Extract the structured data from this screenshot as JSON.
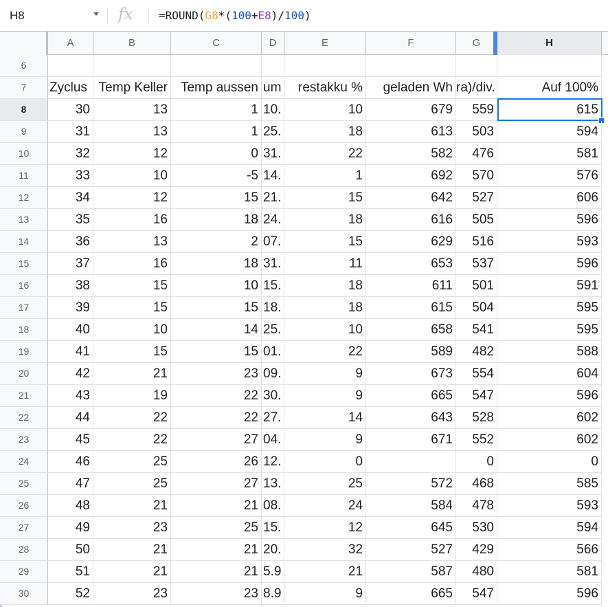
{
  "formula_bar": {
    "cell_ref": "H8",
    "fx_symbol": "fx",
    "formula_parts": [
      {
        "text": "=ROUND(",
        "color": "#202124"
      },
      {
        "text": "G8",
        "color": "#f4a62a"
      },
      {
        "text": "*(",
        "color": "#202124"
      },
      {
        "text": "100",
        "color": "#1155cc"
      },
      {
        "text": "+",
        "color": "#202124"
      },
      {
        "text": "E8",
        "color": "#9334e6"
      },
      {
        "text": ")/",
        "color": "#202124"
      },
      {
        "text": "100",
        "color": "#1155cc"
      },
      {
        "text": ")",
        "color": "#202124"
      }
    ]
  },
  "columns": [
    "A",
    "B",
    "C",
    "D",
    "E",
    "F",
    "G",
    "H"
  ],
  "selected_column": "H",
  "selected_row": "8",
  "rows": [
    {
      "num": "6",
      "cells": [
        "",
        "",
        "",
        "",
        "",
        "",
        "",
        ""
      ]
    },
    {
      "num": "7",
      "cells": [
        "Zyclus",
        "Temp Keller",
        "Temp aussen",
        "um",
        "restakku %",
        "geladen Wh",
        "ra)/div.",
        "Auf 100%"
      ]
    },
    {
      "num": "8",
      "cells": [
        "30",
        "13",
        "1",
        "10.",
        "10",
        "679",
        "559",
        "615"
      ]
    },
    {
      "num": "9",
      "cells": [
        "31",
        "13",
        "1",
        "25.",
        "18",
        "613",
        "503",
        "594"
      ]
    },
    {
      "num": "10",
      "cells": [
        "32",
        "12",
        "0",
        "31.",
        "22",
        "582",
        "476",
        "581"
      ]
    },
    {
      "num": "11",
      "cells": [
        "33",
        "10",
        "-5",
        "14.",
        "1",
        "692",
        "570",
        "576"
      ]
    },
    {
      "num": "12",
      "cells": [
        "34",
        "12",
        "15",
        "21.",
        "15",
        "642",
        "527",
        "606"
      ]
    },
    {
      "num": "13",
      "cells": [
        "35",
        "16",
        "18",
        "24.",
        "18",
        "616",
        "505",
        "596"
      ]
    },
    {
      "num": "14",
      "cells": [
        "36",
        "13",
        "2",
        "07.",
        "15",
        "629",
        "516",
        "593"
      ]
    },
    {
      "num": "15",
      "cells": [
        "37",
        "16",
        "18",
        "31.",
        "11",
        "653",
        "537",
        "596"
      ]
    },
    {
      "num": "16",
      "cells": [
        "38",
        "15",
        "10",
        "15.",
        "18",
        "611",
        "501",
        "591"
      ]
    },
    {
      "num": "17",
      "cells": [
        "39",
        "15",
        "15",
        "18.",
        "18",
        "615",
        "504",
        "595"
      ]
    },
    {
      "num": "18",
      "cells": [
        "40",
        "10",
        "14",
        "25.",
        "10",
        "658",
        "541",
        "595"
      ]
    },
    {
      "num": "19",
      "cells": [
        "41",
        "15",
        "15",
        "01.",
        "22",
        "589",
        "482",
        "588"
      ]
    },
    {
      "num": "20",
      "cells": [
        "42",
        "21",
        "23",
        "09.",
        "9",
        "673",
        "554",
        "604"
      ]
    },
    {
      "num": "21",
      "cells": [
        "43",
        "19",
        "22",
        "30.",
        "9",
        "665",
        "547",
        "596"
      ]
    },
    {
      "num": "22",
      "cells": [
        "44",
        "22",
        "22",
        "27.",
        "14",
        "643",
        "528",
        "602"
      ]
    },
    {
      "num": "23",
      "cells": [
        "45",
        "22",
        "27",
        "04.",
        "9",
        "671",
        "552",
        "602"
      ]
    },
    {
      "num": "24",
      "cells": [
        "46",
        "25",
        "26",
        "12.",
        "0",
        "",
        "0",
        "0"
      ]
    },
    {
      "num": "25",
      "cells": [
        "47",
        "25",
        "27",
        "13.",
        "25",
        "572",
        "468",
        "585"
      ]
    },
    {
      "num": "26",
      "cells": [
        "48",
        "21",
        "21",
        "08.",
        "24",
        "584",
        "478",
        "593"
      ]
    },
    {
      "num": "27",
      "cells": [
        "49",
        "23",
        "25",
        "15.",
        "12",
        "645",
        "530",
        "594"
      ]
    },
    {
      "num": "28",
      "cells": [
        "50",
        "21",
        "21",
        "20.",
        "32",
        "527",
        "429",
        "566"
      ]
    },
    {
      "num": "29",
      "cells": [
        "51",
        "21",
        "21",
        "5.9",
        "21",
        "587",
        "480",
        "581"
      ]
    },
    {
      "num": "30",
      "cells": [
        "52",
        "23",
        "23",
        "8.9",
        "9",
        "665",
        "547",
        "596"
      ]
    }
  ],
  "colors": {
    "selection": "#1a73e8",
    "header_bg": "#f8f9fa",
    "gridline": "#e2e2e2"
  }
}
